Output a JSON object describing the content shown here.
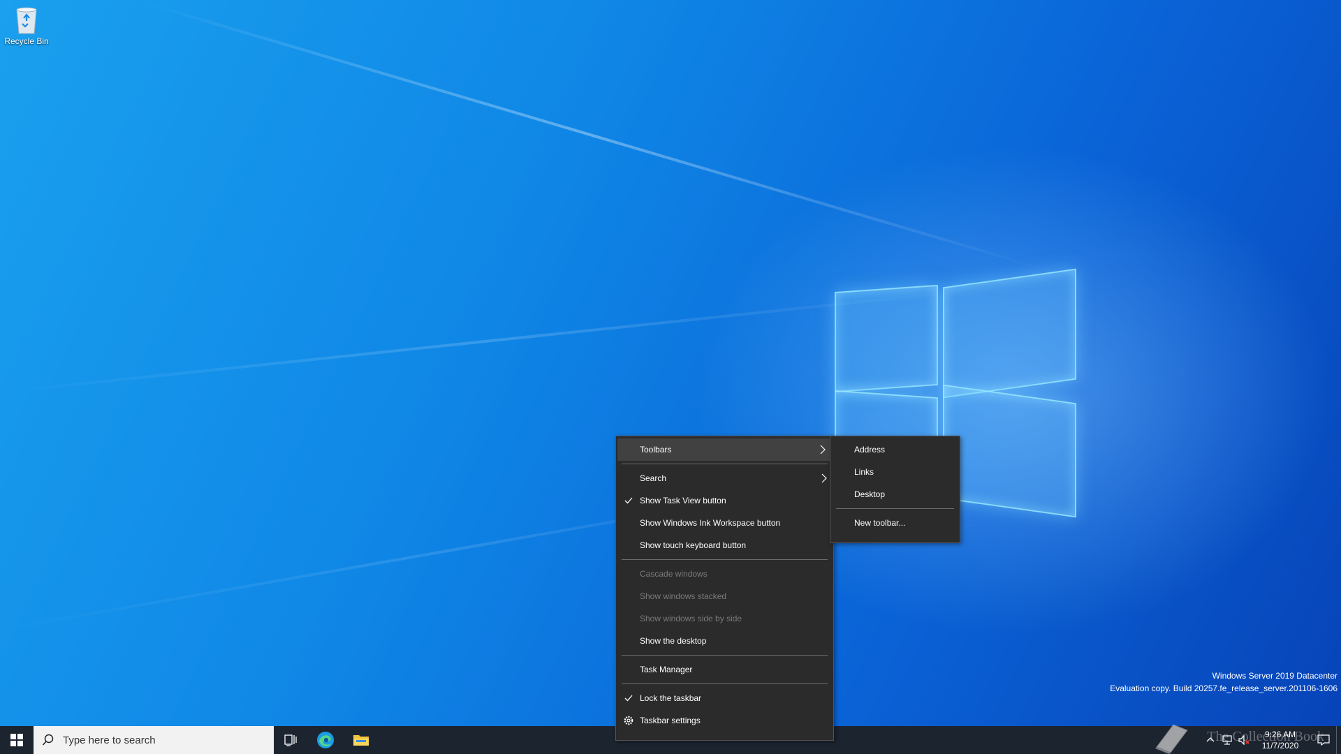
{
  "desktop": {
    "recycle_bin_label": "Recycle Bin",
    "watermark": {
      "line1": "Windows Server 2019 Datacenter",
      "line2": "Evaluation copy. Build 20257.fe_release_server.201106-1606"
    },
    "overlay_text": "The Collection Book"
  },
  "taskbar": {
    "search_placeholder": "Type here to search",
    "clock_time": "9:26 AM",
    "clock_date": "11/7/2020",
    "color": "#1c2430"
  },
  "context_menu": {
    "items": [
      {
        "label": "Toolbars",
        "has_submenu": true,
        "highlighted": true
      },
      {
        "label": "Search",
        "has_submenu": true
      },
      {
        "label": "Show Task View button",
        "checked": true
      },
      {
        "label": "Show Windows Ink Workspace button"
      },
      {
        "label": "Show touch keyboard button"
      },
      {
        "label": "Cascade windows",
        "disabled": true
      },
      {
        "label": "Show windows stacked",
        "disabled": true
      },
      {
        "label": "Show windows side by side",
        "disabled": true
      },
      {
        "label": "Show the desktop"
      },
      {
        "label": "Task Manager"
      },
      {
        "label": "Lock the taskbar",
        "checked": true
      },
      {
        "label": "Taskbar settings",
        "icon": "gear-icon"
      }
    ]
  },
  "toolbars_submenu": {
    "items": [
      {
        "label": "Address"
      },
      {
        "label": "Links"
      },
      {
        "label": "Desktop"
      },
      {
        "label": "New toolbar..."
      }
    ]
  },
  "colors": {
    "menu_bg": "#2b2b2b",
    "menu_highlight": "#414141",
    "disabled_text": "#7a7a7a",
    "accent_blue": "#0a63d6"
  }
}
